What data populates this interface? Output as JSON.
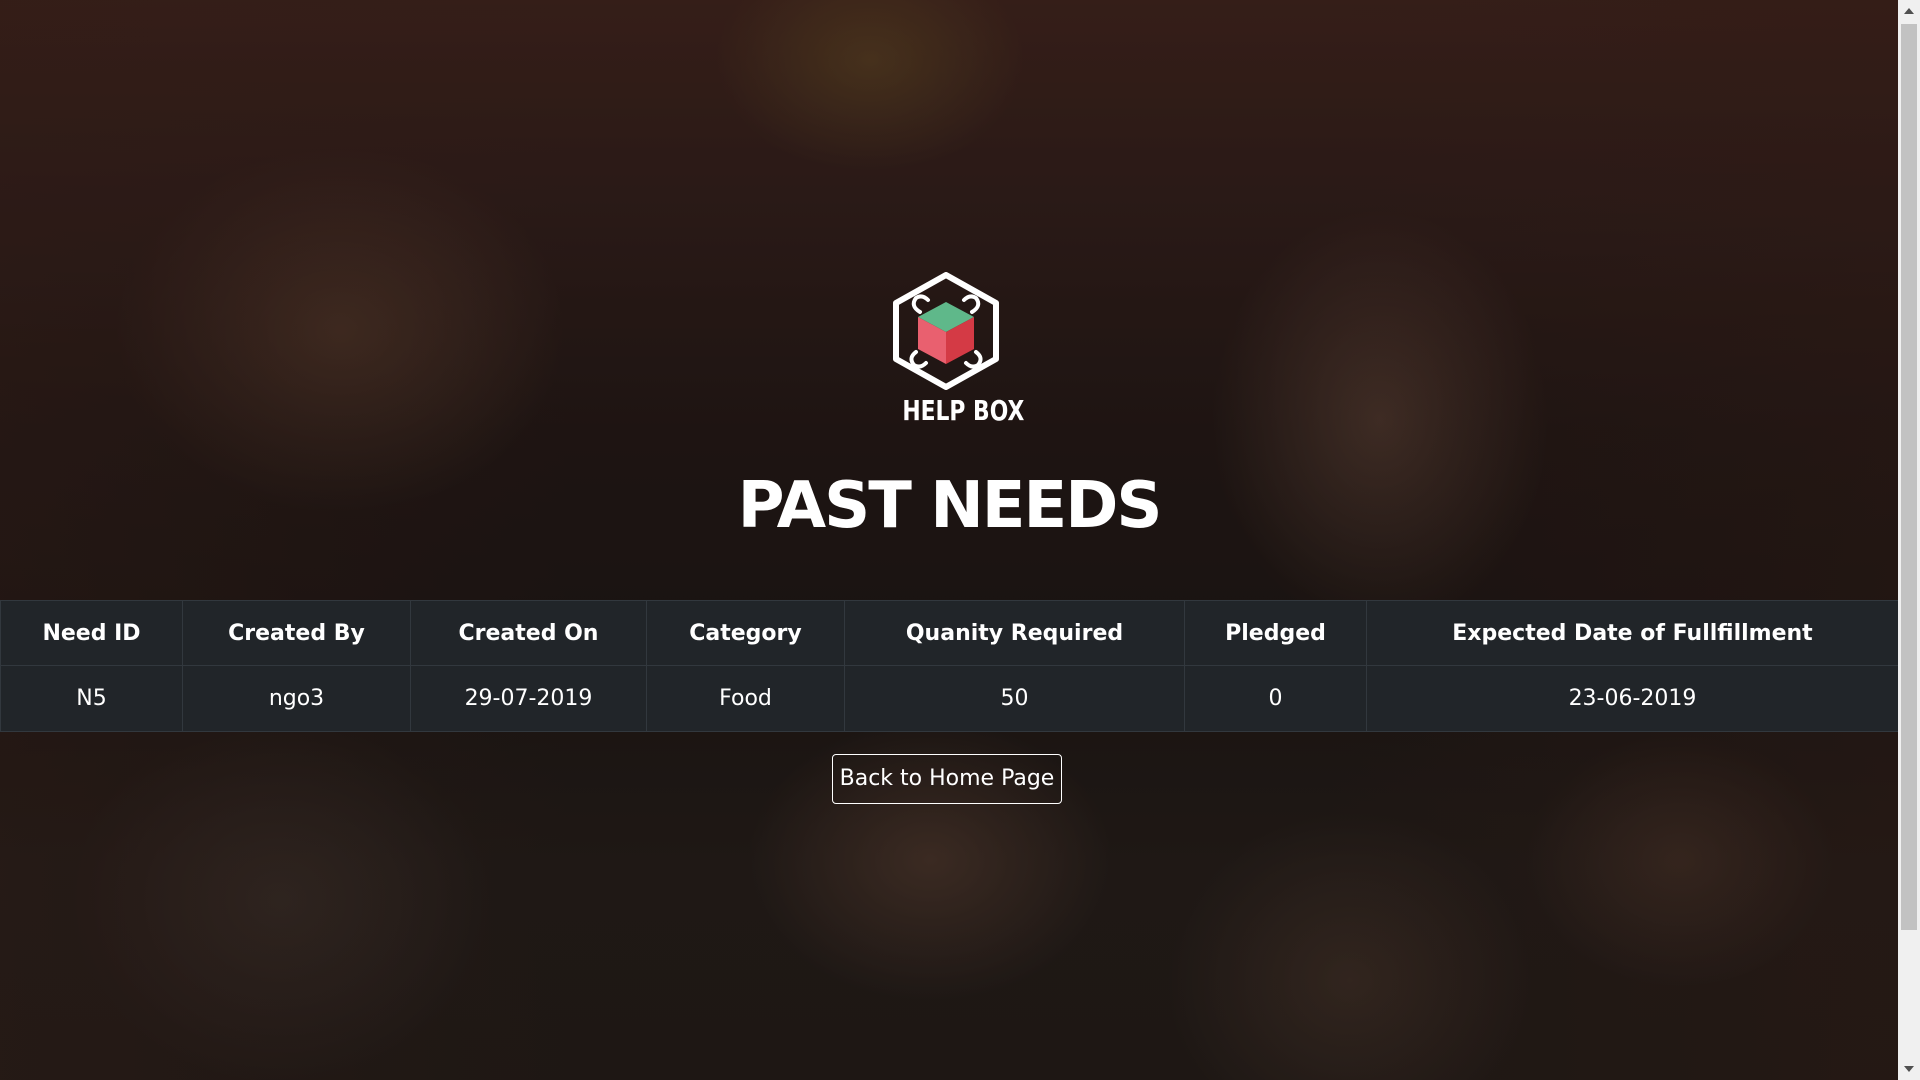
{
  "brand": {
    "name": "HELP BOX",
    "logo_icon": "helping-hands-box-icon",
    "colors": {
      "pink": "#e9606f",
      "green": "#5fb88a",
      "red": "#d43a45"
    }
  },
  "page": {
    "title": "PAST NEEDS"
  },
  "table": {
    "headers": [
      "Need ID",
      "Created By",
      "Created On",
      "Category",
      "Quanity Required",
      "Pledged",
      "Expected Date of Fullfillment"
    ],
    "rows": [
      [
        "N5",
        "ngo3",
        "29-07-2019",
        "Food",
        "50",
        "0",
        "23-06-2019"
      ]
    ]
  },
  "actions": {
    "back_label": "Back to Home Page"
  },
  "theme": {
    "table_bg": "#212529",
    "table_border": "#32383e",
    "text": "#ffffff"
  }
}
